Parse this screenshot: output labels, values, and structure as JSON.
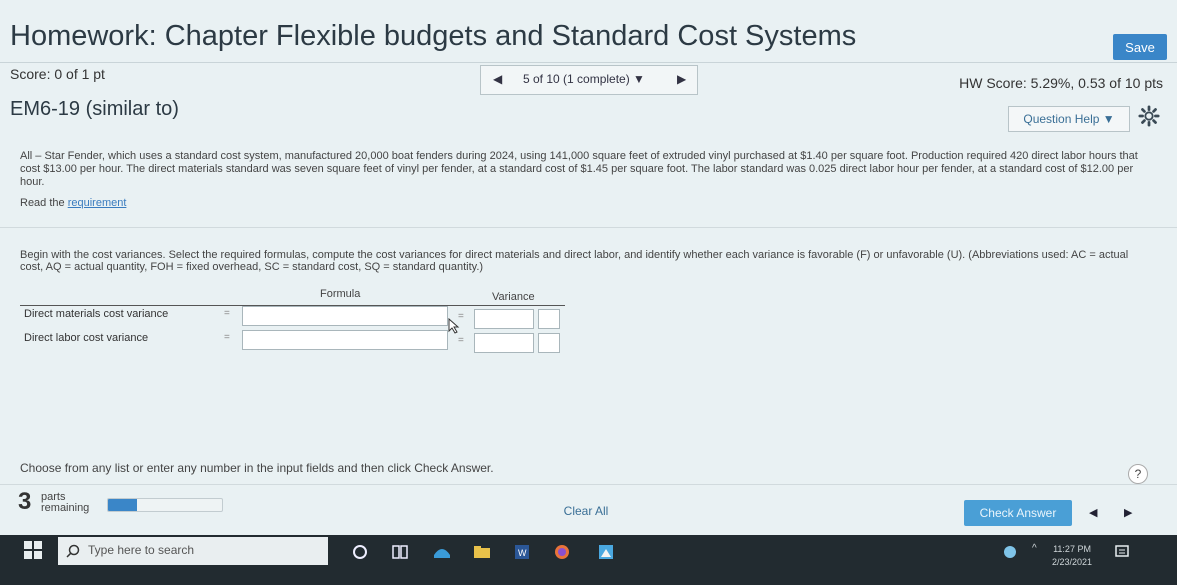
{
  "header": {
    "title": "Homework: Chapter Flexible budgets and Standard Cost Systems",
    "save_label": "Save"
  },
  "score_bar": {
    "score": "Score: 0 of 1 pt",
    "nav_text": "5 of 10 (1 complete) ▼",
    "hw_score": "HW Score: 5.29%, 0.53 of 10 pts"
  },
  "question": {
    "id": "EM6-19 (similar to)",
    "help_label": "Question Help ▼",
    "problem_text": "All – Star Fender, which uses a standard cost system, manufactured 20,000 boat fenders during 2024, using 141,000 square feet of extruded vinyl purchased at $1.40 per square foot. Production required 420 direct labor hours that cost $13.00 per hour. The direct materials standard was seven square feet of vinyl per fender, at a standard cost of $1.45 per square foot. The labor standard was 0.025 direct labor hour per fender, at a standard cost of $12.00 per hour.",
    "read_prefix": "Read the ",
    "read_link": "requirement",
    "instructions": "Begin with the cost variances. Select the required formulas, compute the cost variances for direct materials and direct labor, and identify whether each variance is favorable (F) or unfavorable (U). (Abbreviations used: AC = actual cost, AQ = actual quantity, FOH = fixed overhead, SC = standard cost, SQ = standard quantity.)"
  },
  "table": {
    "header_formula": "Formula",
    "header_variance": "Variance",
    "rows": [
      {
        "label": "Direct materials cost variance",
        "formula_value": "",
        "variance_value": "",
        "fu_value": ""
      },
      {
        "label": "Direct labor cost variance",
        "formula_value": "",
        "variance_value": "",
        "fu_value": ""
      }
    ],
    "eq_sign": "="
  },
  "footer": {
    "instruction": "Choose from any list or enter any number in the input fields and then click Check Answer.",
    "help_symbol": "?",
    "parts_count": "3",
    "parts_word1": "parts",
    "parts_word2": "remaining",
    "progress_fraction": 0.25,
    "clear_label": "Clear All",
    "check_label": "Check Answer"
  },
  "taskbar": {
    "search_placeholder": "Type here to search",
    "time": "11:27 PM",
    "date": "2/23/2021"
  },
  "colors": {
    "accent": "#3a86c8",
    "check_button": "#4a9fd6",
    "taskbar": "#222b30"
  }
}
